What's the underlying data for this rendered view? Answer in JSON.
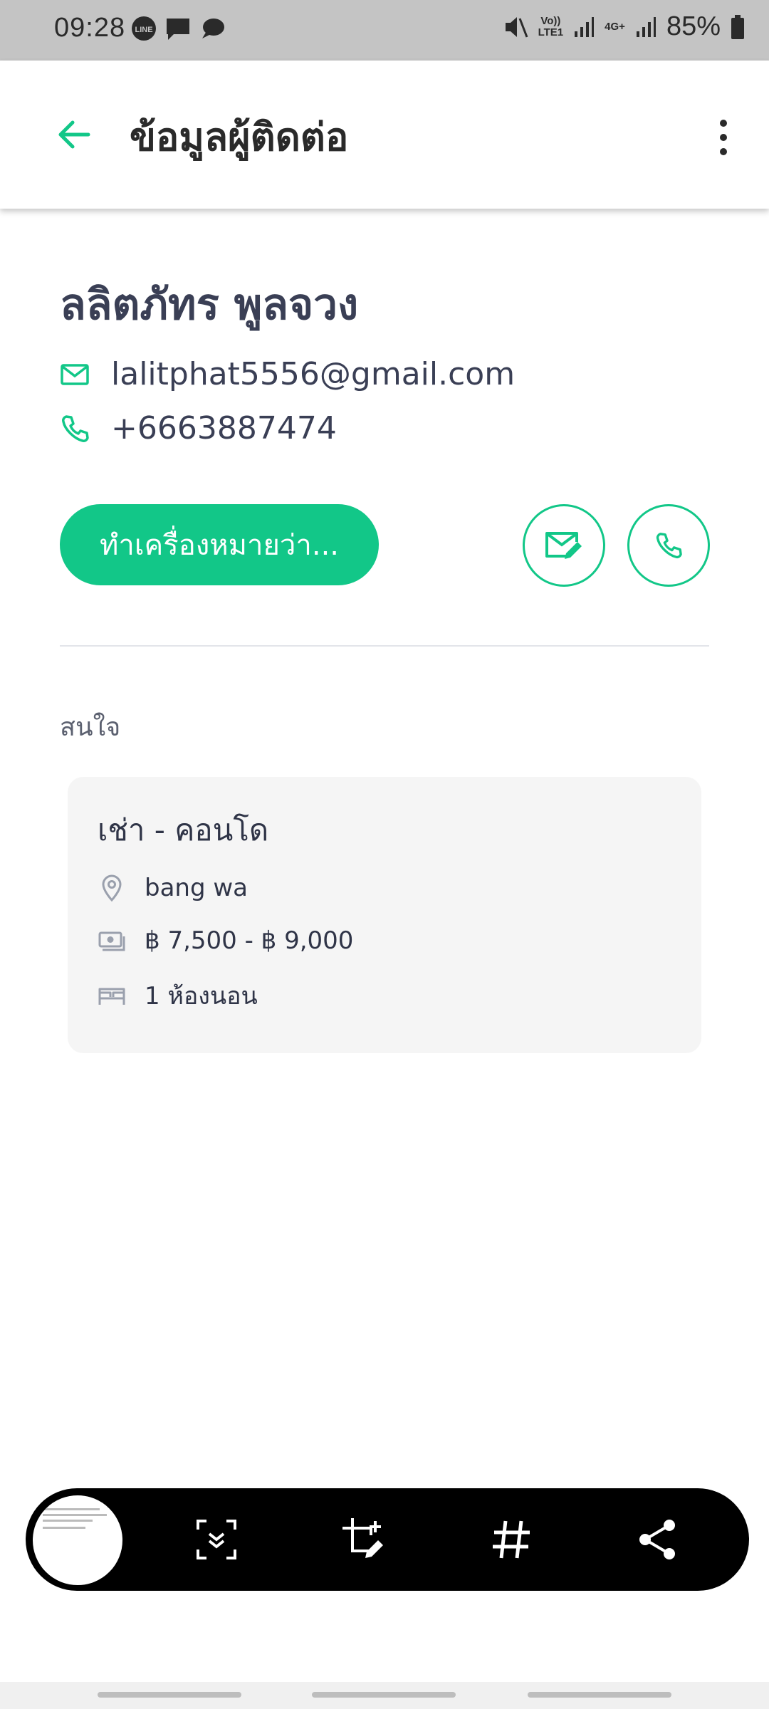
{
  "status_bar": {
    "time": "09:28",
    "left_icons": [
      "line-app-icon",
      "message-icon",
      "chat-bubble-icon"
    ],
    "net_label_1": "Vo))",
    "net_label_1b": "LTE1",
    "net_label_2": "4G+",
    "battery": "85%"
  },
  "header": {
    "title": "ข้อมูลผู้ติดต่อ"
  },
  "contact": {
    "name": "ลลิตภัทร พูลจวง",
    "email": "lalitphat5556@gmail.com",
    "phone": "+6663887474"
  },
  "actions": {
    "primary_label": "ทำเครื่องหมายว่า..."
  },
  "section": {
    "label": "สนใจ"
  },
  "interest": {
    "title": "เช่า - คอนโด",
    "location": "bang wa",
    "price": "฿ 7,500 - ฿ 9,000",
    "bedrooms": "1 ห้องนอน"
  },
  "colors": {
    "accent": "#12c788",
    "text_dark": "#3a3f55",
    "card_bg": "#f5f5f5"
  }
}
